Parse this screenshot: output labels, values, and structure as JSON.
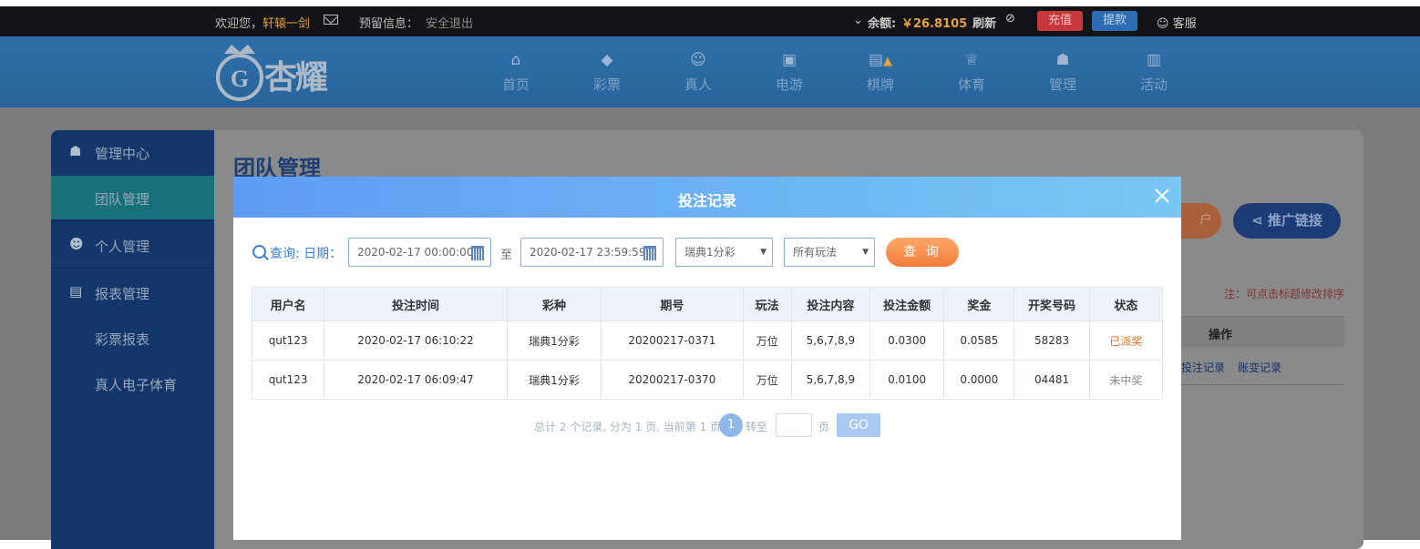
{
  "topbar": {
    "welcome": "欢迎您，",
    "username": "轩辕一剑",
    "reserved_info": "预留信息：",
    "logout": "安全退出",
    "balance_label": "余额:",
    "balance_value": "￥26.8105",
    "refresh": "刷新",
    "recharge": "充值",
    "withdraw": "提款",
    "service": "客服"
  },
  "brand": {
    "name": "杏耀"
  },
  "nav": [
    {
      "label": "首页",
      "icon": "home-icon"
    },
    {
      "label": "彩票",
      "icon": "diamond-icon"
    },
    {
      "label": "真人",
      "icon": "person-icon"
    },
    {
      "label": "电游",
      "icon": "slot-machine-icon"
    },
    {
      "label": "棋牌",
      "icon": "card-icon"
    },
    {
      "label": "体育",
      "icon": "trophy-icon"
    },
    {
      "label": "管理",
      "icon": "users-icon"
    },
    {
      "label": "活动",
      "icon": "gift-icon"
    }
  ],
  "sidebar": {
    "items": [
      {
        "label": "管理中心"
      },
      {
        "label": "团队管理"
      },
      {
        "label": "个人管理"
      },
      {
        "label": "报表管理"
      },
      {
        "label": "彩票报表"
      },
      {
        "label": "真人电子体育"
      }
    ]
  },
  "page": {
    "title": "团队管理",
    "btn_account": "户",
    "btn_promo": "推广链接",
    "note": "注：可点击标题修改排序",
    "col_action": "操作",
    "action_bets": "投注记录",
    "action_changes": "账变记录"
  },
  "modal": {
    "title": "投注记录",
    "query_label": "查询:",
    "date_label": "日期：",
    "date_from": "2020-02-17 00:00:00",
    "to_label": "至",
    "date_to": "2020-02-17 23:59:59",
    "lottery_select": "瑞典1分彩",
    "play_select": "所有玩法",
    "query_button": "查 询",
    "columns": [
      "用户名",
      "投注时间",
      "彩种",
      "期号",
      "玩法",
      "投注内容",
      "投注金额",
      "奖金",
      "开奖号码",
      "状态"
    ],
    "rows": [
      [
        "qut123",
        "2020-02-17 06:10:22",
        "瑞典1分彩",
        "20200217-0371",
        "万位",
        "5,6,7,8,9",
        "0.0300",
        "0.0585",
        "58283",
        "已派奖"
      ],
      [
        "qut123",
        "2020-02-17 06:09:47",
        "瑞典1分彩",
        "20200217-0370",
        "万位",
        "5,6,7,8,9",
        "0.0100",
        "0.0000",
        "04481",
        "未中奖"
      ]
    ],
    "pager": {
      "summary": "总计 2 个记录, 分为 1 页, 当前第 1 页",
      "current": "1",
      "goto": "转至",
      "page_unit": "页",
      "go": "GO"
    }
  },
  "colors": {
    "header": "#2f6fa8",
    "modal_head": "#5e9cf5",
    "accent_orange": "#f47b3a"
  }
}
